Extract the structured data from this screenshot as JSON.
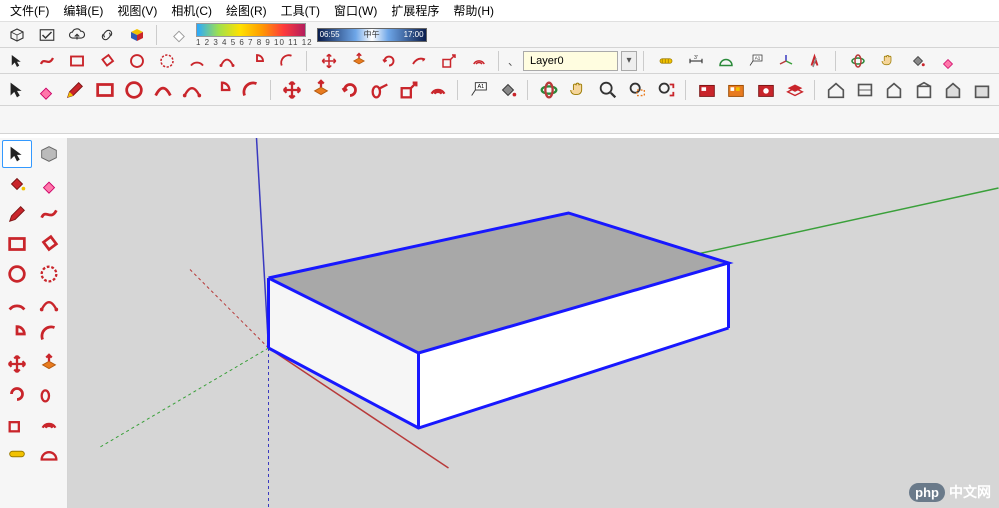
{
  "menu": {
    "file": "文件(F)",
    "edit": "编辑(E)",
    "view": "视图(V)",
    "camera": "相机(C)",
    "draw": "绘图(R)",
    "tools": "工具(T)",
    "window": "窗口(W)",
    "extensions": "扩展程序",
    "help": "帮助(H)"
  },
  "shelf1": {
    "gradient_labels": "1 2 3 4 5 6 7 8 9 10 11 12",
    "time_start": "06:55",
    "time_mid": "中午",
    "time_end": "17:00"
  },
  "shelf2": {
    "layer_selected": "Layer0",
    "layer_prefix": "、"
  },
  "watermark": {
    "badge": "php",
    "text": "中文网"
  },
  "colors": {
    "edge": "#1818ff",
    "axis_red": "#b83a3a",
    "axis_green": "#3aa03a",
    "axis_blue": "#3a3ac0",
    "top_face": "#a8a8a8",
    "side_face": "#f2f2f2"
  }
}
